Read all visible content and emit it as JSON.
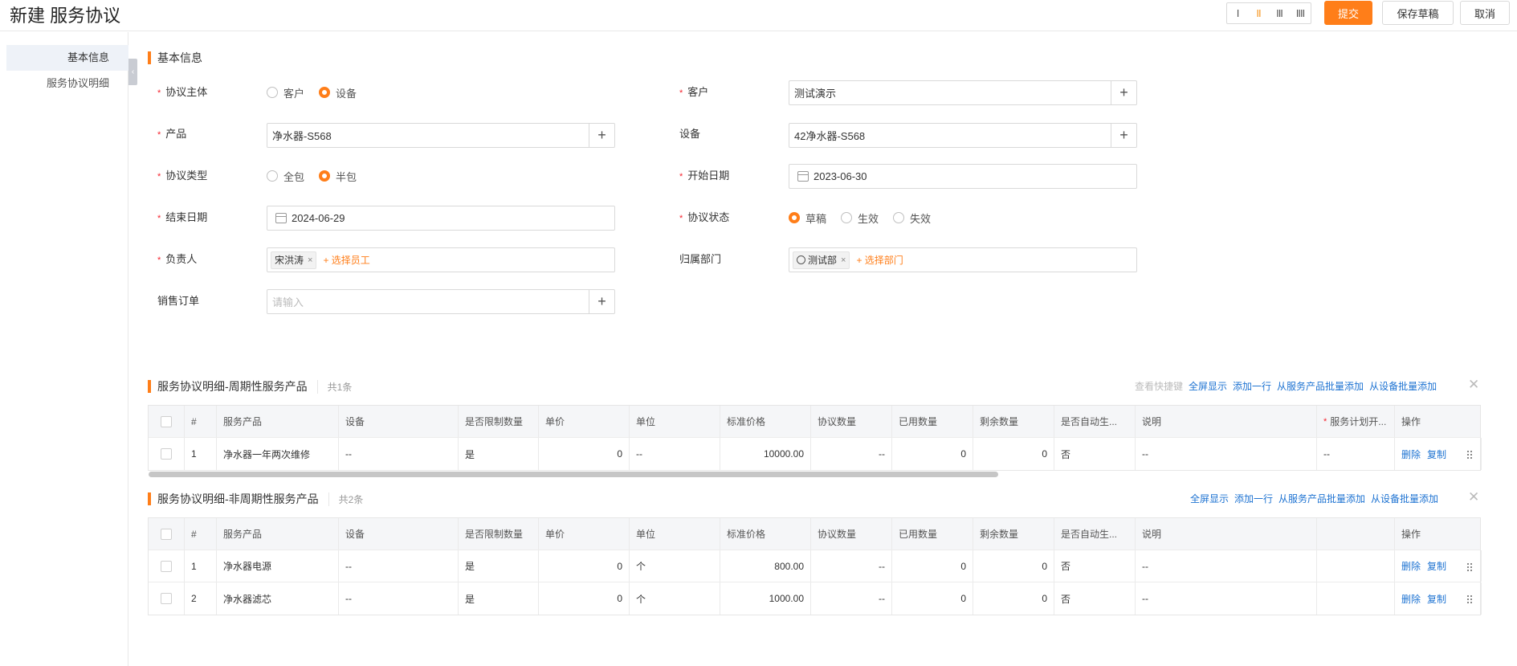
{
  "header": {
    "title": "新建 服务协议",
    "layout_options": [
      "I",
      "II",
      "III",
      "IIII"
    ],
    "submit_label": "提交",
    "save_draft_label": "保存草稿",
    "cancel_label": "取消"
  },
  "sidebar": {
    "items": [
      {
        "label": "基本信息",
        "active": true
      },
      {
        "label": "服务协议明细",
        "active": false
      }
    ]
  },
  "basic_info": {
    "section_title": "基本信息",
    "agreement_subject": {
      "label": "协议主体",
      "options": [
        "客户",
        "设备"
      ],
      "selected": "设备"
    },
    "customer": {
      "label": "客户",
      "value": "测试演示"
    },
    "product": {
      "label": "产品",
      "value": "净水器-S568"
    },
    "device": {
      "label": "设备",
      "value": "42净水器-S568"
    },
    "agreement_type": {
      "label": "协议类型",
      "options": [
        "全包",
        "半包"
      ],
      "selected": "半包"
    },
    "start_date": {
      "label": "开始日期",
      "value": "2023-06-30"
    },
    "end_date": {
      "label": "结束日期",
      "value": "2024-06-29"
    },
    "agreement_status": {
      "label": "协议状态",
      "options": [
        "草稿",
        "生效",
        "失效"
      ],
      "selected": "草稿"
    },
    "owner": {
      "label": "负责人",
      "tag": "宋洪涛",
      "add_label": "+ 选择员工"
    },
    "department": {
      "label": "归属部门",
      "tag": "测试部",
      "add_label": "+ 选择部门"
    },
    "sales_order": {
      "label": "销售订单",
      "placeholder": "请输入"
    }
  },
  "periodic": {
    "title": "服务协议明细-周期性服务产品",
    "count": "共1条",
    "links": [
      "查看快捷键",
      "全屏显示",
      "添加一行",
      "从服务产品批量添加",
      "从设备批量添加"
    ],
    "columns": [
      "#",
      "服务产品",
      "设备",
      "是否限制数量",
      "单价",
      "单位",
      "标准价格",
      "协议数量",
      "已用数量",
      "剩余数量",
      "是否自动生...",
      "说明",
      "服务计划开...",
      "操作"
    ],
    "rows": [
      {
        "no": "1",
        "product": "净水器一年两次维修",
        "device": "--",
        "limit": "是",
        "unit_price": "0",
        "unit": "--",
        "std_price": "10000.00",
        "qty": "--",
        "used": "0",
        "remain": "0",
        "auto": "否",
        "desc": "--",
        "plan": "--",
        "del": "删除",
        "copy": "复制"
      }
    ]
  },
  "non_periodic": {
    "title": "服务协议明细-非周期性服务产品",
    "count": "共2条",
    "links": [
      "全屏显示",
      "添加一行",
      "从服务产品批量添加",
      "从设备批量添加"
    ],
    "columns": [
      "#",
      "服务产品",
      "设备",
      "是否限制数量",
      "单价",
      "单位",
      "标准价格",
      "协议数量",
      "已用数量",
      "剩余数量",
      "是否自动生...",
      "说明",
      "",
      "操作"
    ],
    "rows": [
      {
        "no": "1",
        "product": "净水器电源",
        "device": "--",
        "limit": "是",
        "unit_price": "0",
        "unit": "个",
        "std_price": "800.00",
        "qty": "--",
        "used": "0",
        "remain": "0",
        "auto": "否",
        "desc": "--",
        "plan": "",
        "del": "删除",
        "copy": "复制"
      },
      {
        "no": "2",
        "product": "净水器滤芯",
        "device": "--",
        "limit": "是",
        "unit_price": "0",
        "unit": "个",
        "std_price": "1000.00",
        "qty": "--",
        "used": "0",
        "remain": "0",
        "auto": "否",
        "desc": "--",
        "plan": "",
        "del": "删除",
        "copy": "复制"
      }
    ]
  },
  "colors": {
    "accent": "#ff7e19",
    "link": "#1e73d2",
    "required": "#f5222d"
  }
}
